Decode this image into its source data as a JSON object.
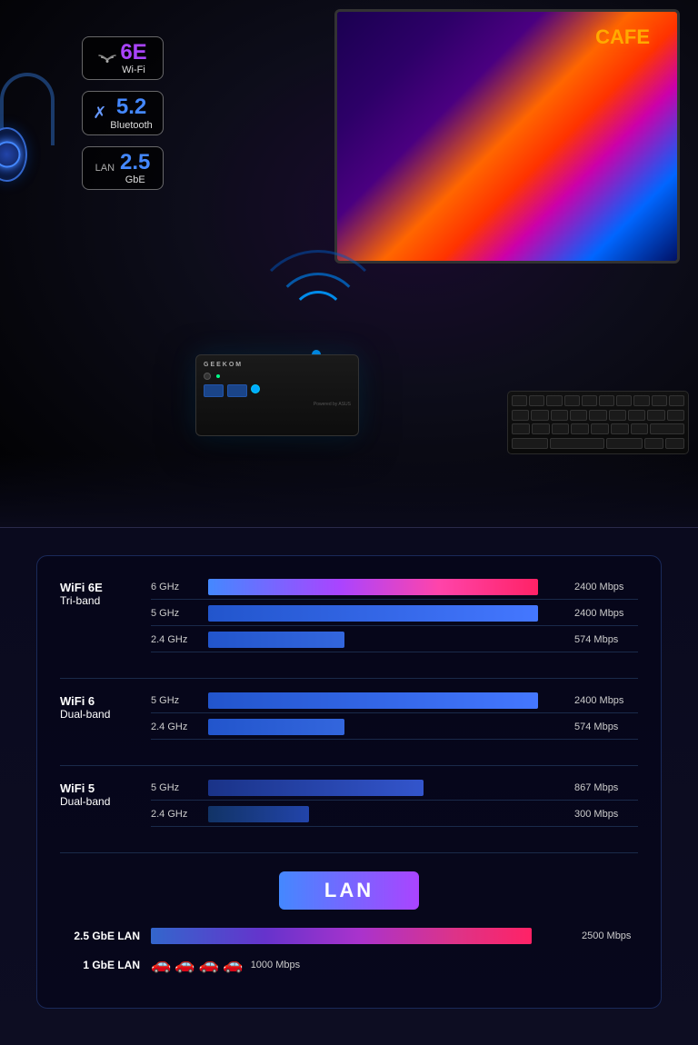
{
  "hero": {
    "wifi_badge": {
      "number": "6E",
      "label": "Wi-Fi",
      "icon": "wifi"
    },
    "bluetooth_badge": {
      "number": "5.2",
      "label": "Bluetooth",
      "icon": "bluetooth"
    },
    "lan_badge": {
      "prefix": "LAN",
      "number": "2.5",
      "label": "GbE",
      "icon": "lan"
    }
  },
  "wifi_section": {
    "wifi6e": {
      "name": "WiFi 6E",
      "sub": "Tri-band",
      "bars": [
        {
          "freq": "6 GHz",
          "speed": "2400 Mbps",
          "width_pct": 92,
          "style": "gradient-hot"
        },
        {
          "freq": "5 GHz",
          "speed": "2400 Mbps",
          "width_pct": 92,
          "style": "gradient-blue"
        },
        {
          "freq": "2.4 GHz",
          "speed": "574 Mbps",
          "width_pct": 38,
          "style": "gradient-short"
        }
      ]
    },
    "wifi6": {
      "name": "WiFi 6",
      "sub": "Dual-band",
      "bars": [
        {
          "freq": "5 GHz",
          "speed": "2400 Mbps",
          "width_pct": 92,
          "style": "gradient-blue"
        },
        {
          "freq": "2.4 GHz",
          "speed": "574 Mbps",
          "width_pct": 38,
          "style": "gradient-short"
        }
      ]
    },
    "wifi5": {
      "name": "WiFi 5",
      "sub": "Dual-band",
      "bars": [
        {
          "freq": "5 GHz",
          "speed": "867 Mbps",
          "width_pct": 60,
          "style": "gradient-med"
        },
        {
          "freq": "2.4 GHz",
          "speed": "300 Mbps",
          "width_pct": 28,
          "style": "gradient-short2"
        }
      ]
    }
  },
  "lan_section": {
    "title": "LAN",
    "rows": [
      {
        "label": "2.5 GbE LAN",
        "speed": "2500 Mbps",
        "width_pct": 90,
        "style": "gradient-lan2",
        "type": "bar"
      },
      {
        "label": "1 GbE LAN",
        "speed": "1000 Mbps",
        "cars": 4,
        "type": "cars"
      }
    ]
  },
  "monitor": {
    "brand": "CAFE",
    "text": "Powered by ASUS"
  },
  "mini_pc": {
    "brand": "GEEKOM",
    "powered_by": "Powered by ASUS"
  }
}
